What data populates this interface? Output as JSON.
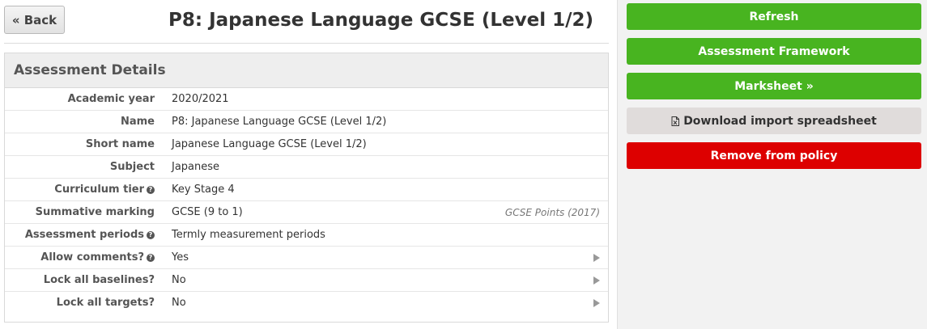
{
  "header": {
    "back_label": "« Back",
    "title": "P8: Japanese Language GCSE (Level 1/2)"
  },
  "panel": {
    "title": "Assessment Details",
    "rows": [
      {
        "label": "Academic year",
        "value": "2020/2021",
        "help": false,
        "note": "",
        "arrow": false
      },
      {
        "label": "Name",
        "value": "P8: Japanese Language GCSE (Level 1/2)",
        "help": false,
        "note": "",
        "arrow": false
      },
      {
        "label": "Short name",
        "value": "Japanese Language GCSE (Level 1/2)",
        "help": false,
        "note": "",
        "arrow": false
      },
      {
        "label": "Subject",
        "value": "Japanese",
        "help": false,
        "note": "",
        "arrow": false
      },
      {
        "label": "Curriculum tier",
        "value": "Key Stage 4",
        "help": true,
        "note": "",
        "arrow": false
      },
      {
        "label": "Summative marking",
        "value": "GCSE (9 to 1)",
        "help": false,
        "note": "GCSE Points (2017)",
        "arrow": false
      },
      {
        "label": "Assessment periods",
        "value": "Termly measurement periods",
        "help": true,
        "note": "",
        "arrow": false
      },
      {
        "label": "Allow comments?",
        "value": "Yes",
        "help": true,
        "note": "",
        "arrow": true
      },
      {
        "label": "Lock all baselines?",
        "value": "No",
        "help": false,
        "note": "",
        "arrow": true
      },
      {
        "label": "Lock all targets?",
        "value": "No",
        "help": false,
        "note": "",
        "arrow": true
      }
    ]
  },
  "sidebar": {
    "refresh_label": "Refresh",
    "framework_label": "Assessment Framework",
    "marksheet_label": "Marksheet »",
    "download_label": "Download import spreadsheet",
    "remove_label": "Remove from policy"
  },
  "colors": {
    "green": "#48b420",
    "red": "#dd0000",
    "grey_button": "#e0dcdb"
  },
  "icons": {
    "help": "question-circle-icon",
    "row_arrow": "caret-right-icon",
    "download": "file-spreadsheet-icon"
  }
}
